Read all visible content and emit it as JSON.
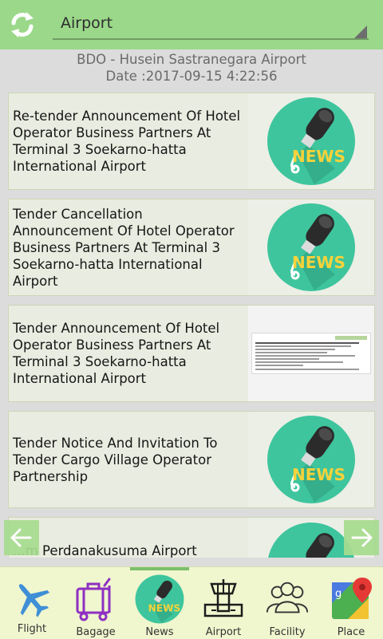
{
  "topbar": {
    "location": "Airport"
  },
  "header": {
    "airport": "BDO - Husein Sastranegara Airport",
    "date": "Date :2017-09-15 4:22:56"
  },
  "news": [
    {
      "title": "Re-tender Announcement Of Hotel Operator Business Partners At Terminal 3 Soekarno-hatta International Airport",
      "thumb": "news-icon"
    },
    {
      "title": "Tender Cancellation Announcement Of Hotel Operator Business Partners At Terminal 3 Soekarno-hatta International Airport",
      "thumb": "news-icon"
    },
    {
      "title": "Tender Announcement Of Hotel Operator Business Partners At Terminal 3 Soekarno-hatta International Airport",
      "thumb": "document-image"
    },
    {
      "title": "Tender Notice And Invitation To Tender Cargo Village Operator Partnership",
      "thumb": "news-icon"
    },
    {
      "title": "...m Perdanakusuma Airport",
      "thumb": "news-icon"
    }
  ],
  "news_badge": "NEWS",
  "tabs": [
    {
      "label": "Flight",
      "icon": "airplane-icon"
    },
    {
      "label": "Bagage",
      "icon": "luggage-icon"
    },
    {
      "label": "News",
      "icon": "news-icon"
    },
    {
      "label": "Airport",
      "icon": "control-tower-icon"
    },
    {
      "label": "Facility",
      "icon": "people-icon"
    },
    {
      "label": "Place",
      "icon": "map-pin-icon"
    }
  ],
  "colors": {
    "topbar": "#9bd88a",
    "accent": "#7bbf6a",
    "bottombar": "#f0f6ce",
    "news_circle": "#3ec59d"
  }
}
